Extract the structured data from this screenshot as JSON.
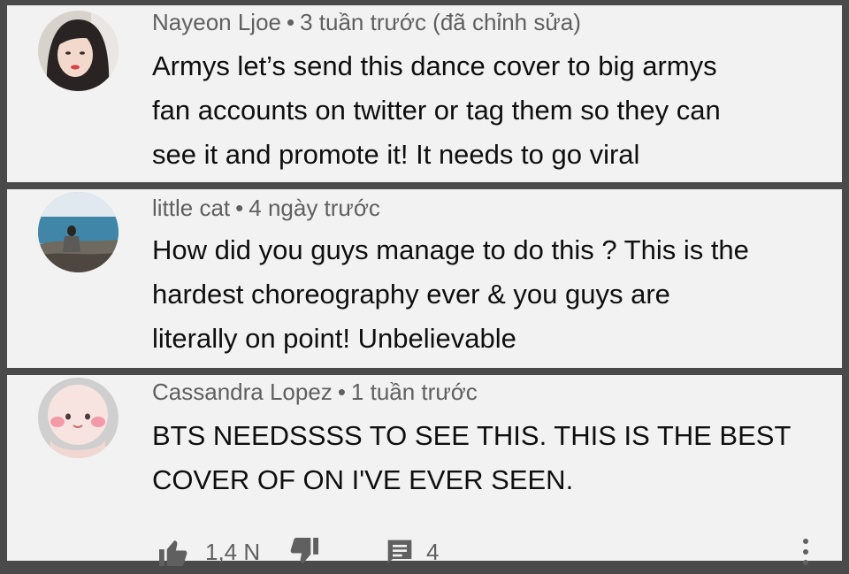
{
  "comments": [
    {
      "author": "Nayeon Ljoe",
      "time": "3 tuần trước (đã chỉnh sửa)",
      "lines": [
        "Armys let’s send this dance cover to big armys",
        "fan accounts on twitter or tag them so they can",
        "see it and promote it! It needs to go viral"
      ]
    },
    {
      "author": "little cat",
      "time": "4 ngày trước",
      "lines": [
        "How did you guys manage to do this ? This is the",
        "hardest choreography ever & you guys are",
        "literally on point! Unbelievable"
      ]
    },
    {
      "author": "Cassandra Lopez",
      "time": "1 tuần trước",
      "lines": [
        "BTS NEEDSSSS TO SEE THIS. THIS IS THE BEST",
        "COVER OF ON I'VE EVER SEEN."
      ],
      "likes": "1,4 N",
      "replies": "4"
    }
  ],
  "separator": "•",
  "icons": [
    "like-icon",
    "dislike-icon",
    "reply-icon",
    "more-options-icon"
  ]
}
